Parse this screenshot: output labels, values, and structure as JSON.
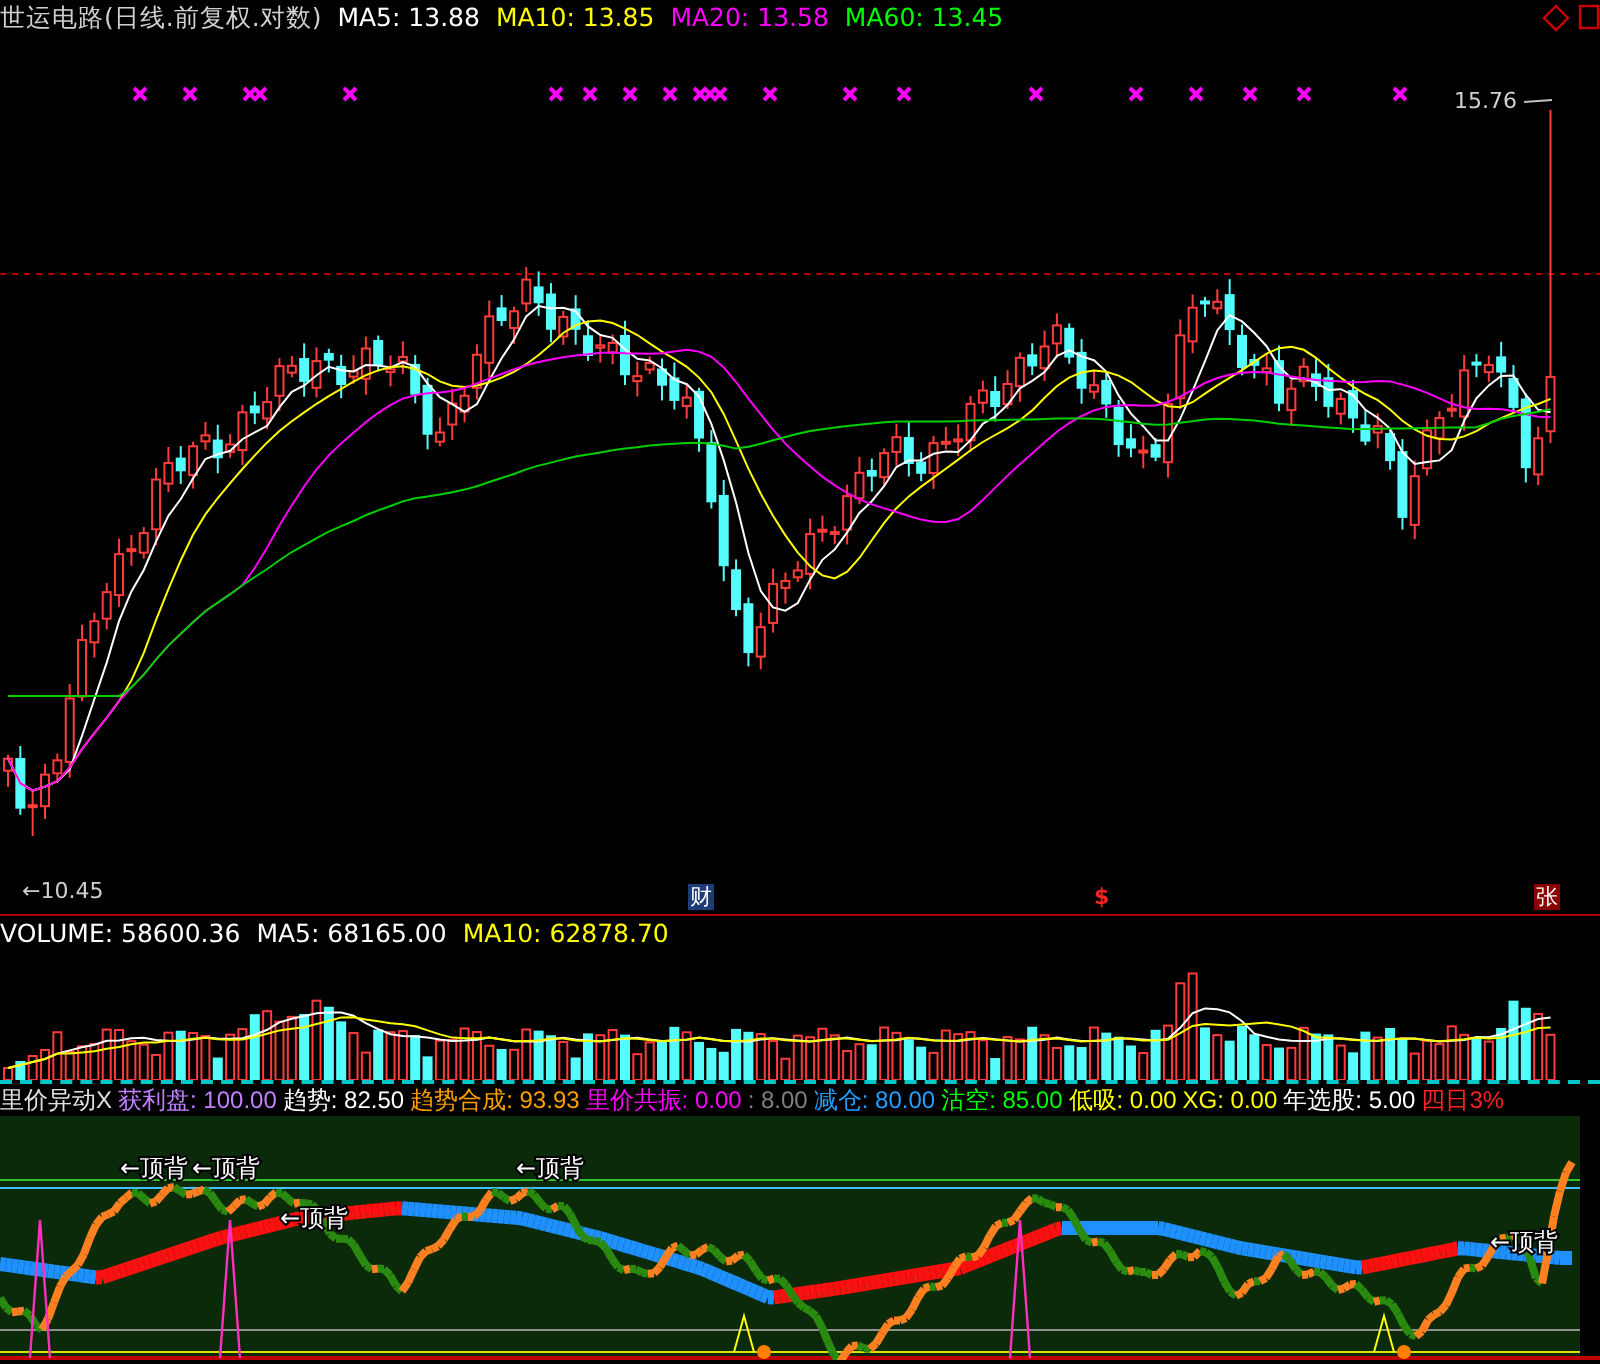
{
  "header": {
    "title": "世运电路(日线.前复权.对数)",
    "indicators": [
      {
        "label": "MA5: 13.88",
        "color": "#ffffff"
      },
      {
        "label": "MA10: 13.85",
        "color": "#ffff00"
      },
      {
        "label": "MA20: 13.58",
        "color": "#ff00ff"
      },
      {
        "label": "MA60: 13.45",
        "color": "#00ff00"
      }
    ]
  },
  "price_chart": {
    "high_label": "15.76",
    "low_label": "←10.45",
    "event_badges": [
      {
        "text": "财",
        "kind": "finance"
      },
      {
        "text": "$",
        "kind": "dollar"
      },
      {
        "text": "张",
        "kind": "rise"
      }
    ]
  },
  "volume_header": {
    "items": [
      {
        "label": "VOLUME: 58600.36",
        "color": "#ffffff"
      },
      {
        "label": "MA5: 68165.00",
        "color": "#ffffff"
      },
      {
        "label": "MA10: 62878.70",
        "color": "#ffff00"
      }
    ]
  },
  "indicator_header": {
    "name": "里价异动X",
    "items": [
      {
        "label": "获利盘: 100.00",
        "kind": "profit"
      },
      {
        "label": "趋势: 82.50",
        "kind": "trend"
      },
      {
        "label": "趋势合成: 93.93",
        "kind": "composite"
      },
      {
        "label": "里价共振: 0.00",
        "kind": "resonance"
      },
      {
        "label": ": 8.00",
        "kind": "auxiliary"
      },
      {
        "label": "减仓: 80.00",
        "kind": "reduce"
      },
      {
        "label": "沽空: 85.00",
        "kind": "short"
      },
      {
        "label": "低吸: 0.00",
        "kind": "dip"
      },
      {
        "label": "XG: 0.00",
        "kind": "pick"
      },
      {
        "label": "年选股: 5.00",
        "kind": "annual"
      },
      {
        "label": "四日3%",
        "kind": "fourday"
      }
    ]
  },
  "indicator_chart": {
    "signals": [
      {
        "text": "←顶背"
      },
      {
        "text": "←顶背"
      },
      {
        "text": "←顶背"
      },
      {
        "text": "←顶背"
      },
      {
        "text": "←顶背"
      }
    ]
  }
}
